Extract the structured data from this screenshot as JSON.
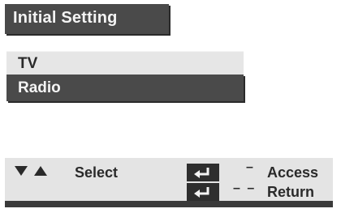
{
  "header": {
    "title": "Initial Setting"
  },
  "menu": {
    "items": [
      {
        "label": "TV",
        "selected": false
      },
      {
        "label": "Radio",
        "selected": true
      }
    ]
  },
  "footer": {
    "nav_icon": "up-down-triangles-icon",
    "select_label": "Select",
    "enter_icon": "enter-key-icon",
    "access_dash": "–",
    "access_label": "Access",
    "return_dash": "– –",
    "return_label": "Return"
  },
  "colors": {
    "selected_bg": "#4a4a4a",
    "normal_bg": "#e6e6e6",
    "footer_bg": "#e4e4e4",
    "text_light": "#f4f4f4",
    "text_dark": "#2a2a2a"
  }
}
